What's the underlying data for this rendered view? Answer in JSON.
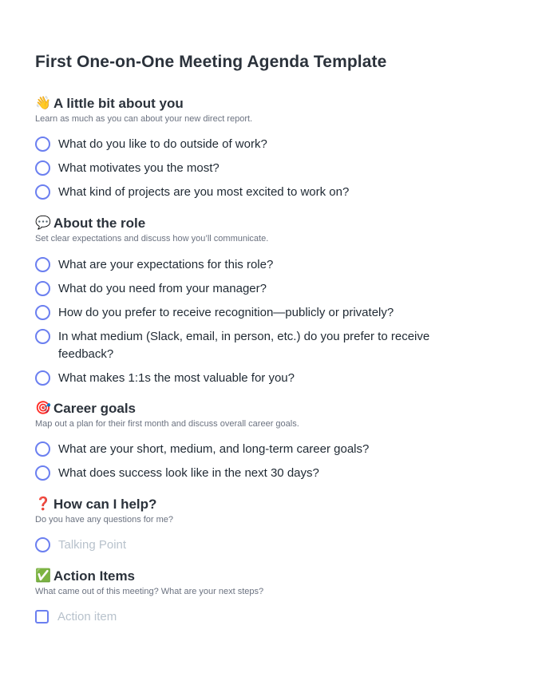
{
  "title": "First One-on-One Meeting Agenda Template",
  "sections": [
    {
      "icon": "waving-hand-icon",
      "emoji": "👋",
      "heading": "A little bit about you",
      "description": "Learn as much as you can about your new direct report.",
      "items": [
        "What do you like to do outside of work?",
        "What motivates you the most?",
        "What kind of projects are you most excited to work on?"
      ]
    },
    {
      "icon": "speech-bubble-icon",
      "emoji": "💬",
      "heading": "About the role",
      "description": "Set clear expectations and discuss how you’ll communicate.",
      "items": [
        "What are your expectations for this role?",
        "What do you need from your manager?",
        "How do you prefer to receive recognition—publicly or privately?",
        "In what medium (Slack, email, in person, etc.) do you prefer to receive feedback?",
        "What makes 1:1s the most valuable for you?"
      ]
    },
    {
      "icon": "target-icon",
      "emoji": "🎯",
      "heading": "Career goals",
      "description": "Map out a plan for their first month and discuss overall career goals.",
      "items": [
        "What are your short, medium, and long-term career goals?",
        "What does success look like in the next 30 days?"
      ]
    },
    {
      "icon": "question-mark-icon",
      "emoji": "❓",
      "heading": "How can I help?",
      "description": "Do you have any questions for me?",
      "placeholder": "Talking Point"
    },
    {
      "icon": "check-mark-icon",
      "emoji": "✅",
      "heading": "Action Items",
      "description": "What came out of this meeting? What are your next steps?",
      "placeholder": "Action item"
    }
  ],
  "colors": {
    "accent": "#6b7ff0",
    "heading": "#2b323b",
    "muted": "#6b7280",
    "placeholder": "#b8c2cc"
  }
}
